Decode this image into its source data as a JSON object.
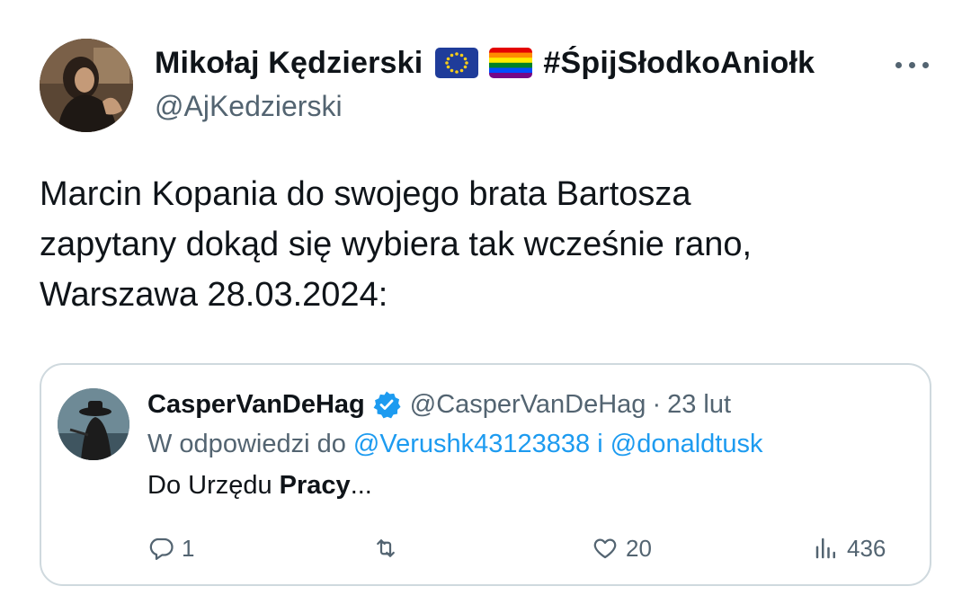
{
  "author": {
    "display_name": "Mikołaj Kędzierski",
    "flag_icons": [
      "eu-flag-icon",
      "rainbow-flag-icon"
    ],
    "hashtag": "#ŚpijSłodkoAniołk",
    "handle": "@AjKedzierski"
  },
  "tweet": {
    "lines": [
      "Marcin Kopania do swojego brata Bartosza",
      "zapytany dokąd się wybiera tak wcześnie rano,",
      "Warszawa 28.03.2024:"
    ]
  },
  "quoted": {
    "display_name": "CasperVanDeHag",
    "verified": true,
    "handle": "@CasperVanDeHag",
    "separator": "·",
    "date": "23 lut",
    "reply_prefix": "W odpowiedzi do",
    "mention_1": "@Verushk43123838",
    "mention_joiner": "i",
    "mention_2": "@donaldtusk",
    "text_plain": "Do Urzędu ",
    "text_bold": "Pracy",
    "text_suffix": "...",
    "actions": {
      "replies": "1",
      "retweets": "",
      "likes": "20",
      "views": "436"
    }
  },
  "colors": {
    "text_primary": "#0f1419",
    "text_secondary": "#536471",
    "link": "#1d9bf0",
    "border": "#cfd9de",
    "verified_badge": "#1d9bf0"
  },
  "icons": {
    "more": "more-horizontal-icon",
    "reply": "reply-icon",
    "retweet": "retweet-icon",
    "like": "heart-icon",
    "views": "views-chart-icon",
    "verified": "verified-badge-icon"
  }
}
